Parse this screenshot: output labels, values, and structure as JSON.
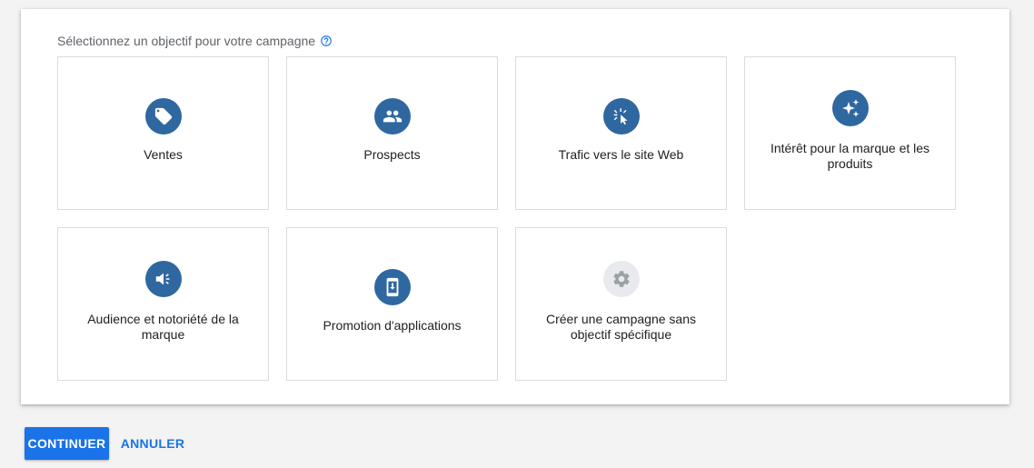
{
  "heading": "Sélectionnez un objectif pour votre campagne",
  "objectives": [
    {
      "label": "Ventes",
      "icon": "tag-icon"
    },
    {
      "label": "Prospects",
      "icon": "people-icon"
    },
    {
      "label": "Trafic vers le site Web",
      "icon": "cursor-click-icon"
    },
    {
      "label": "Intérêt pour la marque et les produits",
      "icon": "sparkle-icon"
    },
    {
      "label": "Audience et notoriété de la marque",
      "icon": "megaphone-icon"
    },
    {
      "label": "Promotion d'applications",
      "icon": "phone-download-icon"
    },
    {
      "label": "Créer une campagne sans objectif spécifique",
      "icon": "gear-icon"
    }
  ],
  "buttons": {
    "continue": "CONTINUER",
    "cancel": "ANNULER"
  },
  "colors": {
    "icon_bg": "#2f67a0",
    "icon_bg_disabled": "#e8eaed",
    "primary": "#1a73e8"
  }
}
